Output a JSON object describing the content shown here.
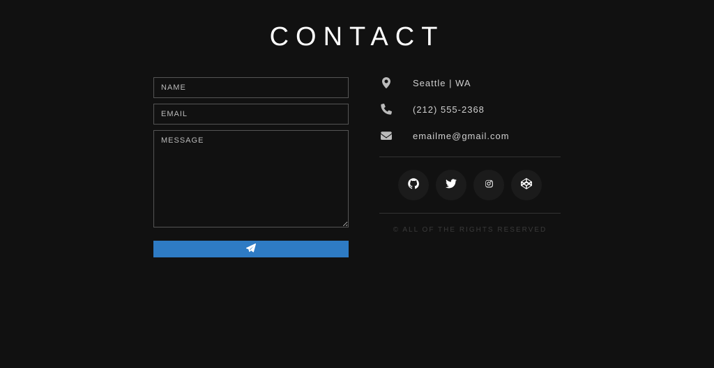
{
  "title": "CONTACT",
  "form": {
    "name_placeholder": "NAME",
    "email_placeholder": "EMAIL",
    "message_placeholder": "MESSAGE"
  },
  "contact": {
    "location": "Seattle | WA",
    "phone": "(212) 555-2368",
    "email": "emailme@gmail.com"
  },
  "socials": [
    "github",
    "twitter",
    "instagram",
    "codepen"
  ],
  "copyright": "© ALL OF THE RIGHTS RESERVED"
}
